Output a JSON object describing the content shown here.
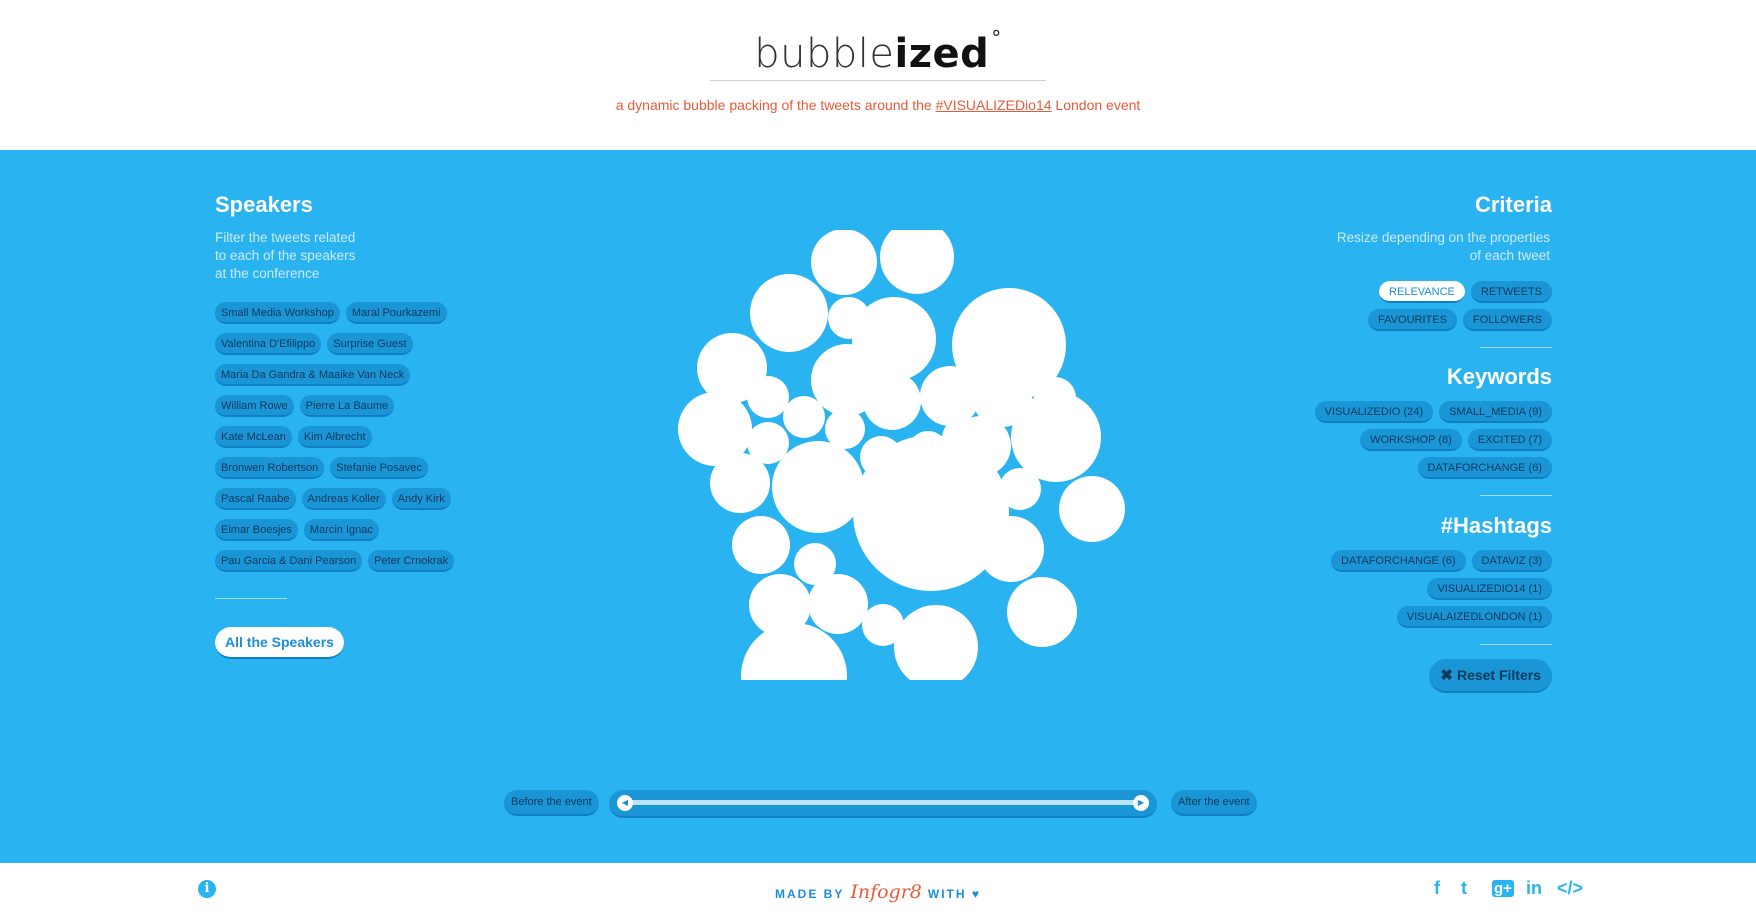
{
  "header": {
    "logo_light": "bubble",
    "logo_bold": "ized",
    "logo_mark": "°",
    "tagline_pre": "a dynamic bubble packing of the tweets around the ",
    "tagline_hash": "#VISUALIZEDio14",
    "tagline_post": " London event"
  },
  "speakers": {
    "title": "Speakers",
    "desc_lines": [
      "Filter the tweets related",
      "to each of the speakers",
      "at the conference"
    ],
    "rows": [
      [
        "Small Media Workshop",
        "Maral Pourkazemi"
      ],
      [
        "Valentina D'Efilippo",
        "Surprise Guest"
      ],
      [
        "Maria Da Gandra & Maaike Van Neck"
      ],
      [
        "William Rowe",
        "Pierre La Baume"
      ],
      [
        "Kate McLean",
        "Kim Albrecht"
      ],
      [
        "Bronwen Robertson",
        "Stefanie Posavec"
      ],
      [
        "Pascal Raabe",
        "Andreas Koller",
        "Andy Kirk"
      ],
      [
        "Eimar Boesjes",
        "Marcin Ignac"
      ],
      [
        "Pau Garcia & Dani Pearson",
        "Peter Crnokrak"
      ]
    ],
    "all_label": "All the Speakers"
  },
  "criteria": {
    "title": "Criteria",
    "desc_lines": [
      "Resize depending on the properties",
      "of each tweet"
    ],
    "row1": [
      "RELEVANCE",
      "RETWEETS"
    ],
    "row2": [
      "FAVOURITES",
      "FOLLOWERS"
    ],
    "active": "RELEVANCE"
  },
  "keywords": {
    "title": "Keywords",
    "row1": [
      "VISUALIZEDIO (24)",
      "SMALL_MEDIA (9)"
    ],
    "row2": [
      "WORKSHOP (8)",
      "EXCITED (7)"
    ],
    "row3": [
      "DATAFORCHANGE (6)"
    ]
  },
  "hashtags": {
    "title": "#Hashtags",
    "row1": [
      "DATAFORCHANGE (6)",
      "DATAVIZ (3)"
    ],
    "row2": [
      "VISUALIZEDIO14 (1)"
    ],
    "row3": [
      "VISUALAIZEDLONDON (1)"
    ]
  },
  "reset_label": "Reset Filters",
  "reset_icon": "✖",
  "timeline": {
    "before_label": "Before the event",
    "after_label": "After the event",
    "range": [
      0.0,
      1.0
    ]
  },
  "footer": {
    "info_icon": "i",
    "made_by": "MADE BY",
    "brand": "Infogr8",
    "with": "WITH",
    "heart": "♥",
    "social": [
      "f",
      "t",
      "g+",
      "in",
      "</>"
    ]
  },
  "colors": {
    "main_bg": "#29b3f1",
    "accent_red": "#e85a3a",
    "tag_bg": "#1a95d6"
  }
}
